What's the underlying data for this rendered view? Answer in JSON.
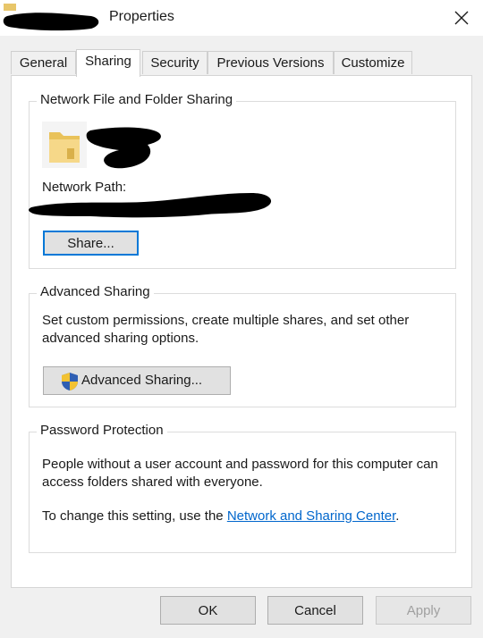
{
  "window": {
    "title": "Properties",
    "close_icon": "close-icon"
  },
  "tabs": [
    {
      "label": "General"
    },
    {
      "label": "Sharing",
      "active": true
    },
    {
      "label": "Security"
    },
    {
      "label": "Previous Versions"
    },
    {
      "label": "Customize"
    }
  ],
  "network_sharing": {
    "group_title": "Network File and Folder Sharing",
    "folder_icon": "folder-icon",
    "network_path_label": "Network Path:",
    "share_button": "Share..."
  },
  "advanced_sharing": {
    "group_title": "Advanced Sharing",
    "description": "Set custom permissions, create multiple shares, and set other advanced sharing options.",
    "button_label": "Advanced Sharing...",
    "button_icon": "shield-icon"
  },
  "password_protection": {
    "group_title": "Password Protection",
    "description": "People without a user account and password for this computer can access folders shared with everyone.",
    "change_text": "To change this setting, use the",
    "link_text": "Network and Sharing Center",
    "period": "."
  },
  "footer": {
    "ok_label": "OK",
    "cancel_label": "Cancel",
    "apply_label": "Apply"
  },
  "colors": {
    "accent": "#0078d7",
    "link": "#0066cc",
    "disabled_text": "#a0a0a0"
  }
}
